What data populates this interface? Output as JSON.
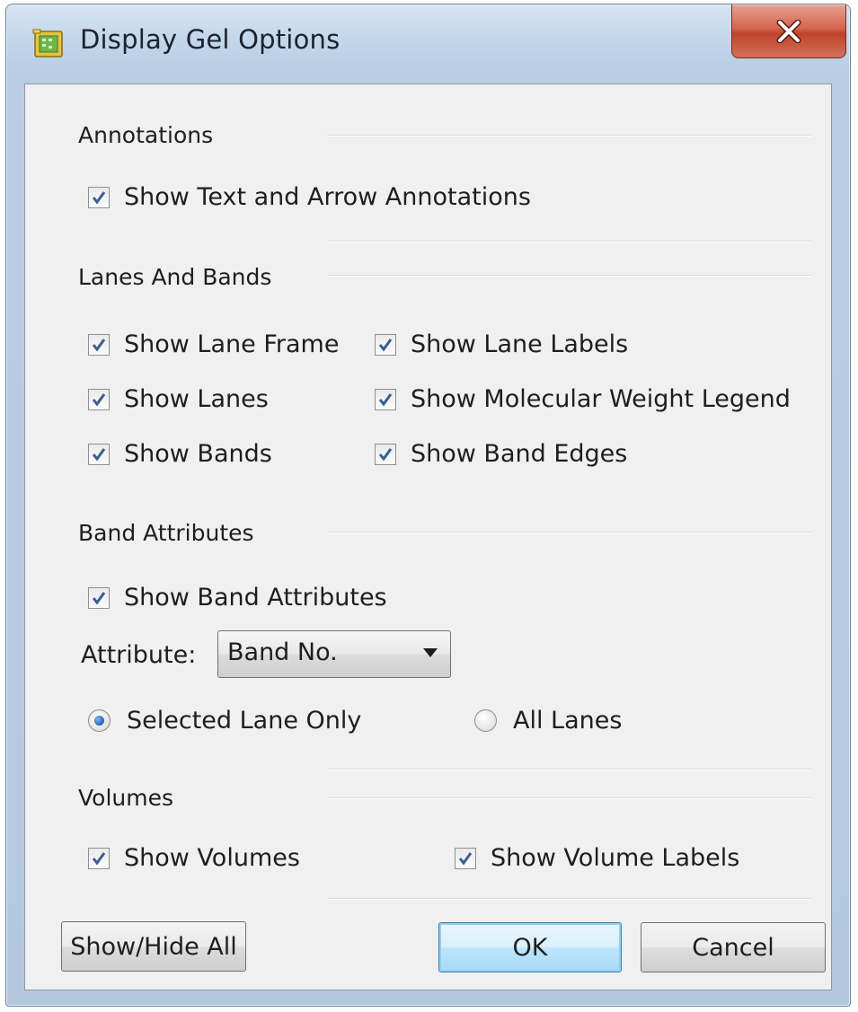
{
  "window": {
    "title": "Display Gel Options",
    "close_glyph": "X"
  },
  "annotations": {
    "heading": "Annotations",
    "show_text_arrow": {
      "label": "Show Text and Arrow Annotations",
      "checked": true
    }
  },
  "lanes_bands": {
    "heading": "Lanes And Bands",
    "show_lane_frame": {
      "label": "Show Lane Frame",
      "checked": true
    },
    "show_lane_labels": {
      "label": "Show Lane Labels",
      "checked": true
    },
    "show_lanes": {
      "label": "Show Lanes",
      "checked": true
    },
    "show_mw_legend": {
      "label": "Show Molecular Weight Legend",
      "checked": true
    },
    "show_bands": {
      "label": "Show Bands",
      "checked": true
    },
    "show_band_edges": {
      "label": "Show Band Edges",
      "checked": true
    }
  },
  "band_attributes": {
    "heading": "Band Attributes",
    "show_band_attributes": {
      "label": "Show Band Attributes",
      "checked": true
    },
    "attribute_label": "Attribute:",
    "attribute_value": "Band No.",
    "selected_lane_only": {
      "label": "Selected Lane Only",
      "selected": true
    },
    "all_lanes": {
      "label": "All Lanes",
      "selected": false
    }
  },
  "volumes": {
    "heading": "Volumes",
    "show_volumes": {
      "label": "Show Volumes",
      "checked": true
    },
    "show_volume_labels": {
      "label": "Show Volume Labels",
      "checked": true
    }
  },
  "buttons": {
    "show_hide_all": "Show/Hide All",
    "ok": "OK",
    "cancel": "Cancel"
  },
  "colors": {
    "accent": "#2a6cc0",
    "checkmark": "#3b5f8f",
    "close_button": "#c0432b",
    "dialog_background": "#f0f0f0",
    "frame": "#b9cde3"
  },
  "icons": {
    "app": "gel-image-icon",
    "close": "close-icon",
    "checkmark": "checkmark-icon",
    "dropdown": "chevron-down-icon"
  }
}
